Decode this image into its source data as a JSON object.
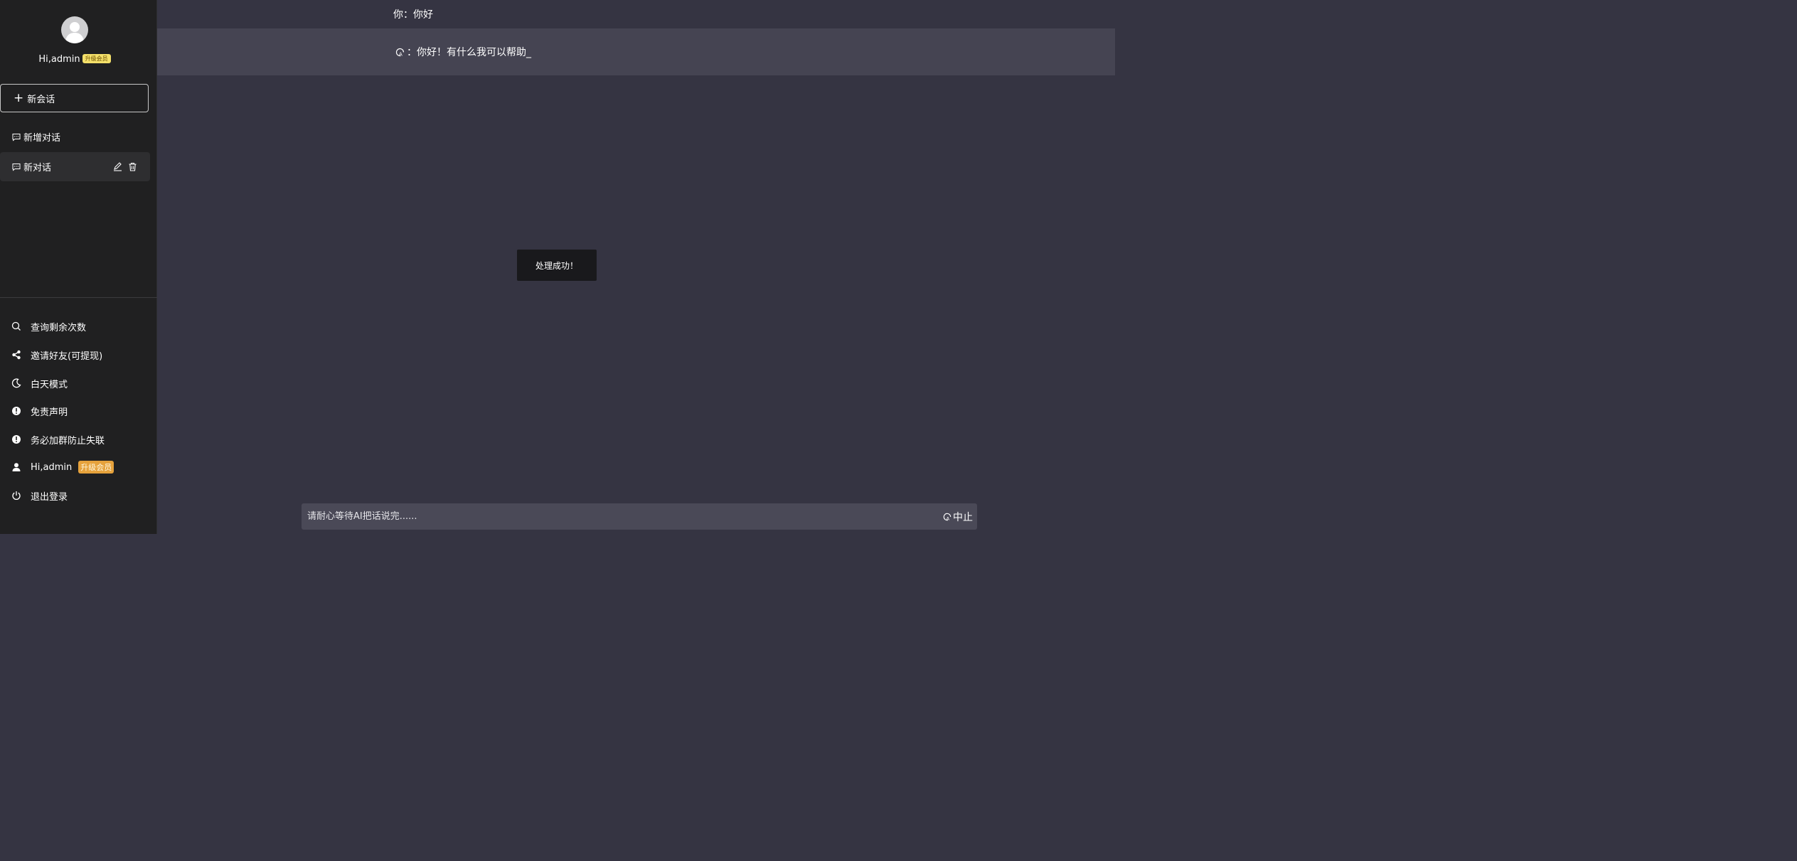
{
  "sidebar": {
    "greeting": "Hi,admin",
    "upgrade_badge": "升级会员",
    "new_chat_label": "新会话",
    "conversations": [
      {
        "label": "新增对话"
      },
      {
        "label": "新对话"
      }
    ],
    "menu": [
      {
        "label": "查询剩余次数",
        "icon": "search-icon"
      },
      {
        "label": "邀请好友(可提现)",
        "icon": "share-icon"
      },
      {
        "label": "白天模式",
        "icon": "moon-icon"
      },
      {
        "label": "免责声明",
        "icon": "alert-icon"
      },
      {
        "label": "务必加群防止失联",
        "icon": "alert-icon"
      },
      {
        "label": "Hi,admin",
        "icon": "user-icon",
        "badge": "升级会员"
      },
      {
        "label": "退出登录",
        "icon": "power-icon"
      }
    ]
  },
  "chat": {
    "user_message": "你：你好",
    "ai_message": "：你好！有什么我可以帮助_"
  },
  "toast": "处理成功！",
  "input": {
    "placeholder": "请耐心等待AI把话说完......",
    "stop_label": "中止"
  },
  "colors": {
    "sidebar_bg": "#202021",
    "main_bg": "#353442",
    "ai_row_bg": "#454452",
    "badge_gold": "#e6a23c",
    "badge_yellow": "#f4e06a"
  }
}
